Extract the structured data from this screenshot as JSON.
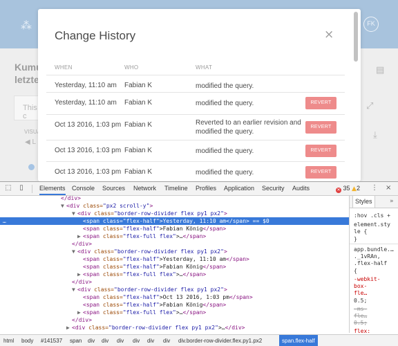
{
  "app": {
    "logo_glyph": "⁂",
    "avatar_initials": "FK",
    "bg_title": "Kumu letzte",
    "bg_card_text": "This c",
    "bg_small_label": "VISUA",
    "bg_link": "◀ L",
    "icons": [
      "list-icon",
      "expand-icon",
      "download-icon"
    ]
  },
  "modal": {
    "title": "Change History",
    "close_glyph": "×",
    "columns": {
      "when": "WHEN",
      "who": "WHO",
      "what": "WHAT"
    },
    "revert_label": "REVERT",
    "rows": [
      {
        "when": "Yesterday, 11:10 am",
        "who": "Fabian K",
        "what": "modified the query.",
        "revert": false
      },
      {
        "when": "Yesterday, 11:10 am",
        "who": "Fabian K",
        "what": "modified the query.",
        "revert": true
      },
      {
        "when": "Oct 13 2016, 1:03 pm",
        "who": "Fabian K",
        "what": "Reverted to an earlier revision and modified the query.",
        "revert": true
      },
      {
        "when": "Oct 13 2016, 1:03 pm",
        "who": "Fabian K",
        "what": "modified the query.",
        "revert": true
      },
      {
        "when": "Oct 13 2016, 1:03 pm",
        "who": "Fabian K",
        "what": "modified the query.",
        "revert": true
      }
    ]
  },
  "devtools": {
    "tabs": [
      "Elements",
      "Console",
      "Sources",
      "Network",
      "Timeline",
      "Profiles",
      "Application",
      "Security",
      "Audits"
    ],
    "active_tab": "Elements",
    "errors": "35",
    "warnings": "2",
    "error_glyph": "⊗",
    "warn_glyph": "▲",
    "kebab_glyph": "⋮",
    "close_glyph": "×",
    "dom_lines": [
      {
        "indent": 11,
        "arrow": "",
        "tag_open": "</div>",
        "attr": "",
        "val": "",
        "text": "",
        "tag_close": "",
        "selected": false
      },
      {
        "indent": 11,
        "arrow": "▼",
        "tag_open": "<div ",
        "attr": "class=",
        "val": "\"px2 scroll-y\"",
        "text": "",
        "tag_close": ">",
        "selected": false
      },
      {
        "indent": 13,
        "arrow": "▼",
        "tag_open": "<div ",
        "attr": "class=",
        "val": "\"border-row-divider flex py1 px2\"",
        "text": "",
        "tag_close": ">",
        "selected": false
      },
      {
        "indent": 15,
        "arrow": "",
        "tag_open": "<span ",
        "attr": "class=",
        "val": "\"flex-half\"",
        "text": ">Yesterday, 11:10 am",
        "tag_close": "</span>",
        "extra": " == $0",
        "selected": true
      },
      {
        "indent": 15,
        "arrow": "",
        "tag_open": "<span ",
        "attr": "class=",
        "val": "\"flex-half\"",
        "text": ">Fabian König",
        "tag_close": "</span>",
        "selected": false
      },
      {
        "indent": 14,
        "arrow": "▶",
        "tag_open": "<span ",
        "attr": "class=",
        "val": "\"flex-full flex\"",
        "text": ">…",
        "tag_close": "</span>",
        "selected": false
      },
      {
        "indent": 13,
        "arrow": "",
        "tag_open": "</div>",
        "attr": "",
        "val": "",
        "text": "",
        "tag_close": "",
        "selected": false
      },
      {
        "indent": 13,
        "arrow": "▼",
        "tag_open": "<div ",
        "attr": "class=",
        "val": "\"border-row-divider flex py1 px2\"",
        "text": "",
        "tag_close": ">",
        "selected": false
      },
      {
        "indent": 15,
        "arrow": "",
        "tag_open": "<span ",
        "attr": "class=",
        "val": "\"flex-half\"",
        "text": ">Yesterday, 11:10 am",
        "tag_close": "</span>",
        "selected": false
      },
      {
        "indent": 15,
        "arrow": "",
        "tag_open": "<span ",
        "attr": "class=",
        "val": "\"flex-half\"",
        "text": ">Fabian König",
        "tag_close": "</span>",
        "selected": false
      },
      {
        "indent": 14,
        "arrow": "▶",
        "tag_open": "<span ",
        "attr": "class=",
        "val": "\"flex-full flex\"",
        "text": ">…",
        "tag_close": "</span>",
        "selected": false
      },
      {
        "indent": 13,
        "arrow": "",
        "tag_open": "</div>",
        "attr": "",
        "val": "",
        "text": "",
        "tag_close": "",
        "selected": false
      },
      {
        "indent": 13,
        "arrow": "▼",
        "tag_open": "<div ",
        "attr": "class=",
        "val": "\"border-row-divider flex py1 px2\"",
        "text": "",
        "tag_close": ">",
        "selected": false
      },
      {
        "indent": 15,
        "arrow": "",
        "tag_open": "<span ",
        "attr": "class=",
        "val": "\"flex-half\"",
        "text": ">Oct 13 2016, 1:03 pm",
        "tag_close": "</span>",
        "selected": false
      },
      {
        "indent": 15,
        "arrow": "",
        "tag_open": "<span ",
        "attr": "class=",
        "val": "\"flex-half\"",
        "text": ">Fabian König",
        "tag_close": "</span>",
        "selected": false
      },
      {
        "indent": 14,
        "arrow": "▶",
        "tag_open": "<span ",
        "attr": "class=",
        "val": "\"flex-full flex\"",
        "text": ">…",
        "tag_close": "</span>",
        "selected": false
      },
      {
        "indent": 13,
        "arrow": "",
        "tag_open": "</div>",
        "attr": "",
        "val": "",
        "text": "",
        "tag_close": "",
        "selected": false
      },
      {
        "indent": 12,
        "arrow": "▶",
        "tag_open": "<div ",
        "attr": "class=",
        "val": "\"border-row-divider flex py1 px2\"",
        "text": ">…",
        "tag_close": "</div>",
        "selected": false
      },
      {
        "indent": 12,
        "arrow": "▶",
        "tag_open": "<div ",
        "attr": "class=",
        "val": "\"border-row-divider flex py1 px2\"",
        "text": ">…",
        "tag_close": "</div>",
        "selected": false
      }
    ],
    "ellipsis": "…",
    "styles": {
      "tab": "Styles",
      "more_glyph": "»",
      "filter": ":hov .cls +",
      "lines": [
        {
          "text": "element.sty",
          "cls": ""
        },
        {
          "text": "le {",
          "cls": ""
        },
        {
          "text": "}",
          "cls": ""
        },
        {
          "text": "app.bundle.…",
          "cls": ""
        },
        {
          "text": "._1vRAn,",
          "cls": ""
        },
        {
          "text": ".flex-half",
          "cls": ""
        },
        {
          "text": "{",
          "cls": ""
        },
        {
          "text": "  -webkit-",
          "cls": "prop"
        },
        {
          "text": "    box-",
          "cls": "prop"
        },
        {
          "text": "    fle…",
          "cls": "prop"
        },
        {
          "text": "    0.5;",
          "cls": ""
        },
        {
          "text": "  -ms-",
          "cls": "strike"
        },
        {
          "text": "    fle…",
          "cls": "strike"
        },
        {
          "text": "    0.5;",
          "cls": "strike"
        },
        {
          "text": "  flex:",
          "cls": "prop"
        },
        {
          "text": "    0.5;",
          "cls": ""
        },
        {
          "text": "}",
          "cls": ""
        }
      ]
    },
    "breadcrumbs": [
      "html",
      "body",
      "#141537",
      "span",
      "div",
      "div",
      "div",
      "div",
      "div",
      "div",
      "div.border-row-divider.flex.py1.px2",
      "span.flex-half"
    ]
  }
}
